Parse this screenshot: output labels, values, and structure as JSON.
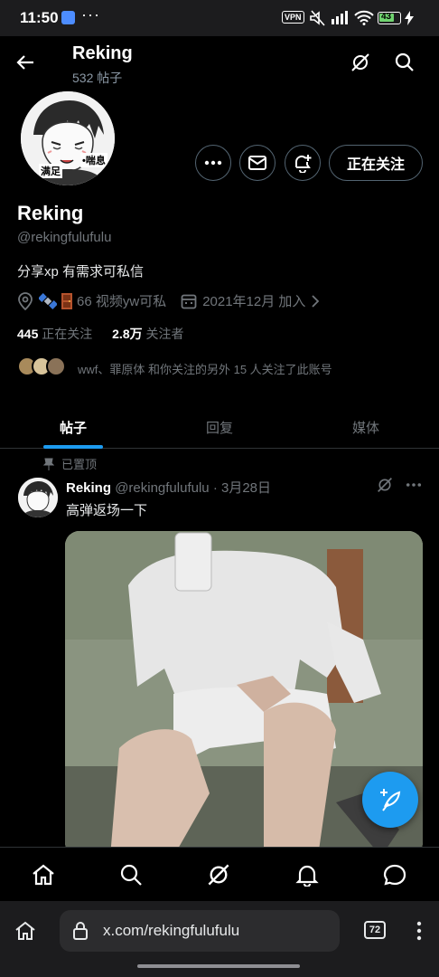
{
  "status_bar": {
    "time": "11:50",
    "more": "···",
    "vpn": "VPN",
    "battery": "43"
  },
  "header": {
    "name": "Reking",
    "post_count": "532 帖子"
  },
  "actions": {
    "follow_label": "正在关注"
  },
  "profile": {
    "name": "Reking",
    "handle": "@rekingfulufulu",
    "bio": "分享xp 有需求可私信",
    "location": "66 视频yw可私",
    "joined": "2021年12月 加入",
    "following_count": "445",
    "following_label": "正在关注",
    "followers_count": "2.8万",
    "followers_label": "关注者",
    "mutual_text": "wwf、罪原体 和你关注的另外 15 人关注了此账号",
    "avatar_caption_1": "满足",
    "avatar_caption_2": "•喘息"
  },
  "tabs": [
    {
      "label": "帖子",
      "active": true
    },
    {
      "label": "回复",
      "active": false
    },
    {
      "label": "媒体",
      "active": false
    }
  ],
  "post": {
    "pinned_label": "已置顶",
    "author_name": "Reking",
    "author_handle": "@rekingfulufulu",
    "separator": "·",
    "date": "3月28日",
    "text": "高弹返场一下"
  },
  "browser": {
    "url": "x.com/rekingfulufulu",
    "tab_count": "72"
  },
  "colors": {
    "accent": "#1d9bf0",
    "background": "#000000",
    "muted": "#71767b",
    "border": "#2f3336"
  }
}
